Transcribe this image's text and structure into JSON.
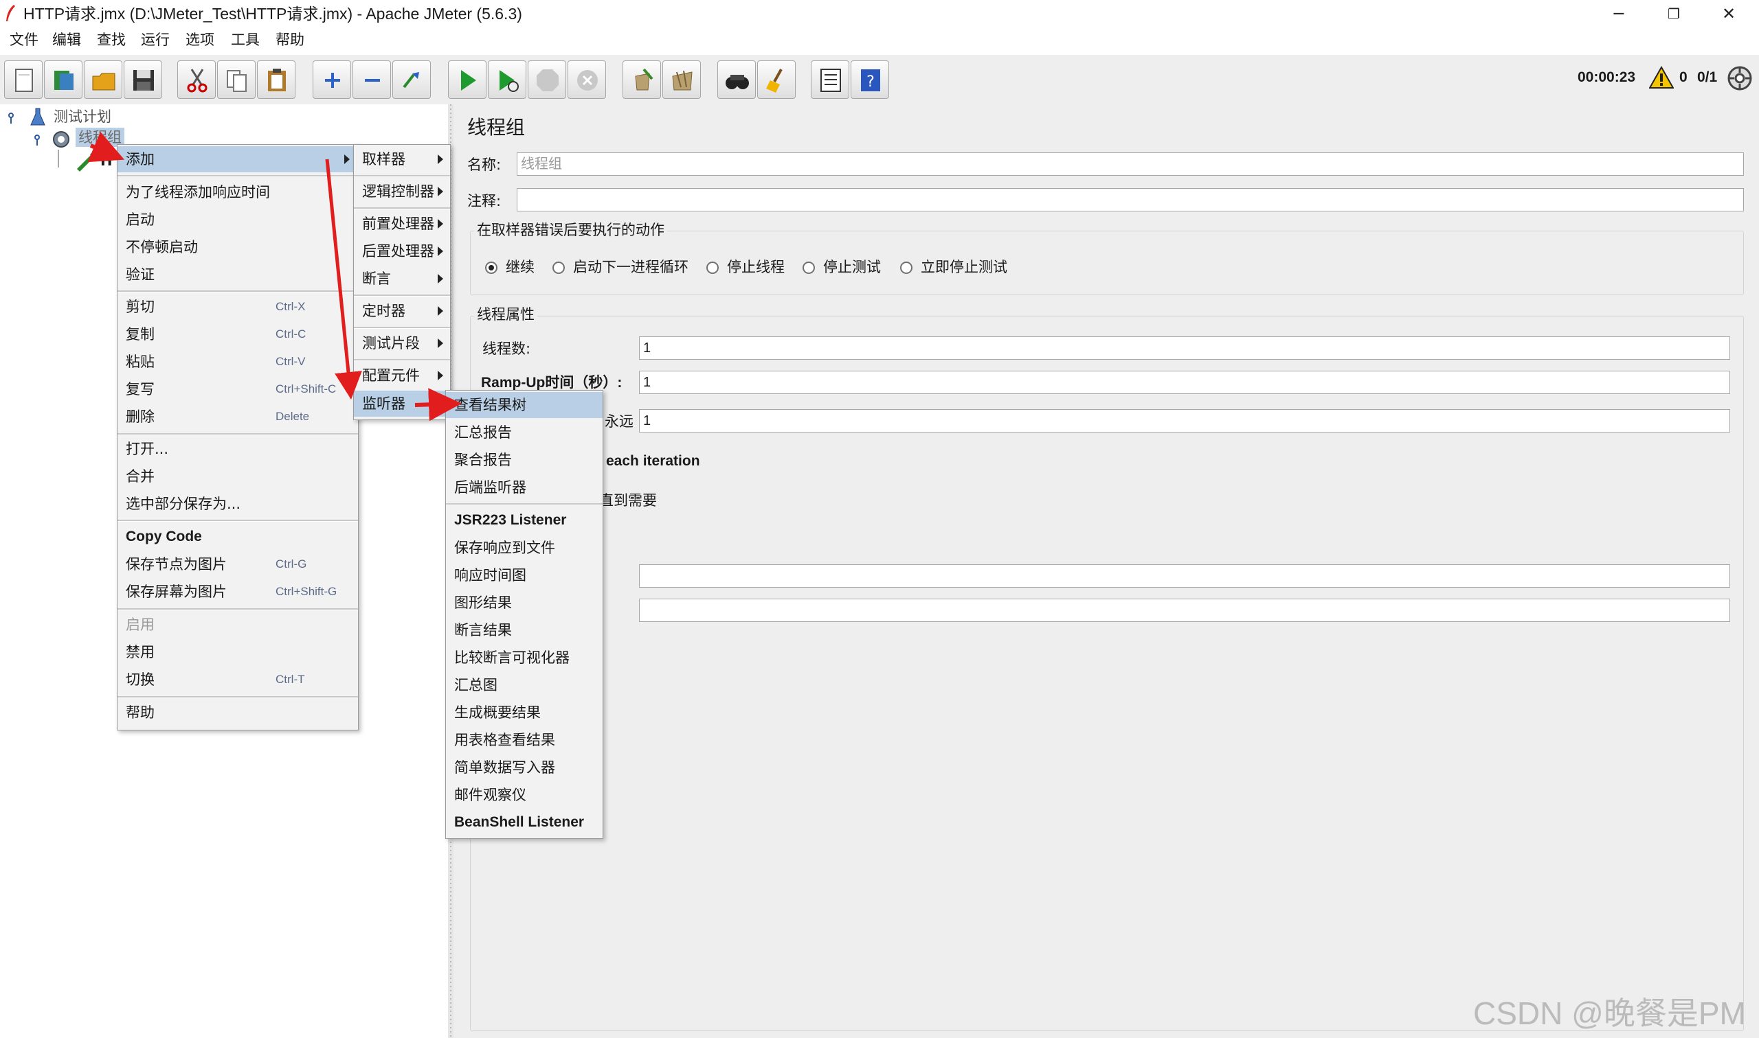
{
  "window": {
    "title": "HTTP请求.jmx (D:\\JMeter_Test\\HTTP请求.jmx) - Apache JMeter (5.6.3)",
    "minimize": "─",
    "restore": "❐",
    "close": "✕"
  },
  "menubar": [
    "文件",
    "编辑",
    "查找",
    "运行",
    "选项",
    "工具",
    "帮助"
  ],
  "toolbar": {
    "timer": "00:00:23",
    "warnings": "0",
    "threads": "0/1",
    "icons": [
      "new-icon",
      "templates-icon",
      "open-icon",
      "save-icon",
      "cut-icon",
      "copy-icon",
      "paste-icon",
      "expand-icon",
      "collapse-icon",
      "toggle-icon",
      "start-icon",
      "start-no-pause-icon",
      "stop-icon",
      "shutdown-icon",
      "clear-icon",
      "clear-all-icon",
      "search-icon",
      "reset-search-icon",
      "function-helper-icon",
      "help-icon",
      "warning-icon",
      "remote-icon"
    ]
  },
  "tree": {
    "root": "测试计划",
    "thread_group": "线程组",
    "child": "H"
  },
  "context_menu": {
    "items": [
      {
        "label": "添加",
        "submenu": true,
        "highlighted": true
      },
      {
        "label": "为了线程添加响应时间"
      },
      {
        "label": "启动"
      },
      {
        "label": "不停顿启动"
      },
      {
        "label": "验证"
      },
      {
        "label": "剪切",
        "shortcut": "Ctrl-X"
      },
      {
        "label": "复制",
        "shortcut": "Ctrl-C"
      },
      {
        "label": "粘贴",
        "shortcut": "Ctrl-V"
      },
      {
        "label": "复写",
        "shortcut": "Ctrl+Shift-C"
      },
      {
        "label": "删除",
        "shortcut": "Delete"
      },
      {
        "label": "打开..."
      },
      {
        "label": "合并"
      },
      {
        "label": "选中部分保存为..."
      },
      {
        "label": "Copy Code"
      },
      {
        "label": "保存节点为图片",
        "shortcut": "Ctrl-G"
      },
      {
        "label": "保存屏幕为图片",
        "shortcut": "Ctrl+Shift-G"
      },
      {
        "label": "启用",
        "disabled": true
      },
      {
        "label": "禁用"
      },
      {
        "label": "切换",
        "shortcut": "Ctrl-T"
      },
      {
        "label": "帮助"
      }
    ]
  },
  "add_submenu": {
    "items": [
      "取样器",
      "逻辑控制器",
      "前置处理器",
      "后置处理器",
      "断言",
      "定时器",
      "测试片段",
      "配置元件",
      "监听器"
    ]
  },
  "listener_submenu": {
    "items": [
      "查看结果树",
      "汇总报告",
      "聚合报告",
      "后端监听器",
      "JSR223 Listener",
      "保存响应到文件",
      "响应时间图",
      "图形结果",
      "断言结果",
      "比较断言可视化器",
      "汇总图",
      "生成概要结果",
      "用表格查看结果",
      "简单数据写入器",
      "邮件观察仪",
      "BeanShell Listener"
    ]
  },
  "panel": {
    "title": "线程组",
    "name_label": "名称:",
    "name_value": "线程组",
    "comment_label": "注释:",
    "comment_value": "",
    "error_section": "在取样器错误后要执行的动作",
    "error_options": [
      "继续",
      "启动下一进程循环",
      "停止线程",
      "停止测试",
      "立即停止测试"
    ],
    "selected_option": "继续",
    "thread_section": "线程属性",
    "threads_label": "线程数:",
    "threads_value": "1",
    "rampup_label": "Ramp-Up时间（秒）:",
    "rampup_value": "1",
    "loop_partial": "永远",
    "loop_value": "1",
    "iteration_partial": "each iteration",
    "delay_partial": "直到需要"
  },
  "watermark": "CSDN @晚餐是PM"
}
